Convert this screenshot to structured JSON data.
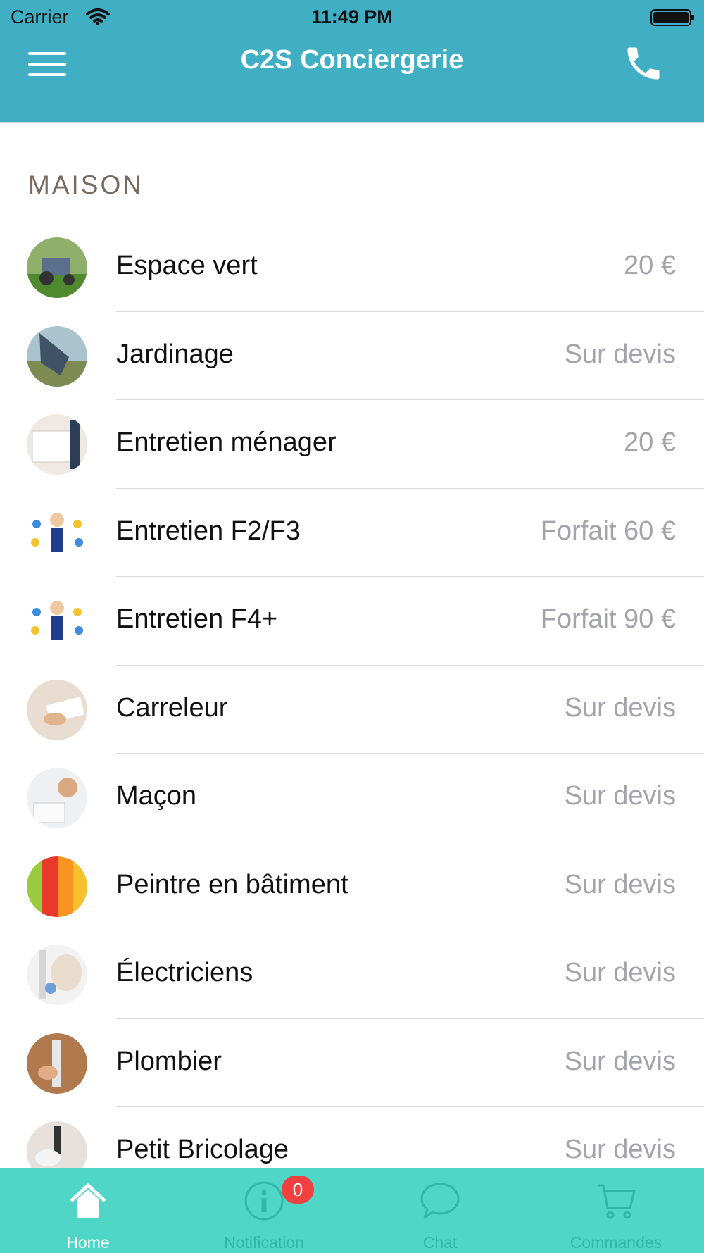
{
  "status_bar": {
    "carrier": "Carrier",
    "time": "11:49 PM"
  },
  "header": {
    "title": "C2S Conciergerie"
  },
  "section": {
    "title": "MAISON"
  },
  "services": [
    {
      "name": "Espace vert",
      "price": "20 €"
    },
    {
      "name": "Jardinage",
      "price": "Sur devis"
    },
    {
      "name": "Entretien ménager",
      "price": "20 €"
    },
    {
      "name": "Entretien F2/F3",
      "price": "Forfait 60 €"
    },
    {
      "name": "Entretien F4+",
      "price": "Forfait 90 €"
    },
    {
      "name": "Carreleur",
      "price": "Sur devis"
    },
    {
      "name": "Maçon",
      "price": "Sur devis"
    },
    {
      "name": "Peintre en bâtiment",
      "price": "Sur devis"
    },
    {
      "name": "Électriciens",
      "price": "Sur devis"
    },
    {
      "name": "Plombier",
      "price": "Sur devis"
    },
    {
      "name": "Petit Bricolage",
      "price": "Sur devis"
    }
  ],
  "tabbar": {
    "home": {
      "label": "Home",
      "icon": "home-icon"
    },
    "notification": {
      "label": "Notification",
      "icon": "info-icon",
      "badge": "0"
    },
    "chat": {
      "label": "Chat",
      "icon": "chat-bubble-icon"
    },
    "orders": {
      "label": "Commandes",
      "icon": "cart-icon"
    }
  },
  "colors": {
    "header": "#40AFC4",
    "tabbar": "#4FD6C6",
    "tab_inactive": "#2fb7a8",
    "badge": "#f04040",
    "price_text": "#a3a3ab",
    "section_title": "#7a6a60"
  }
}
